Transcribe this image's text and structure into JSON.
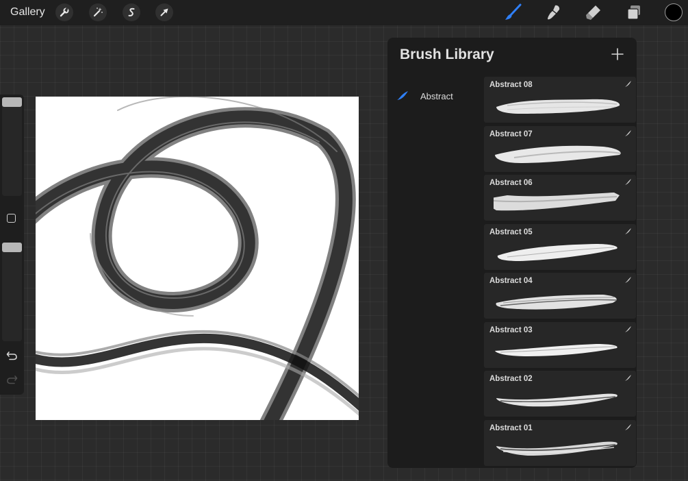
{
  "topbar": {
    "gallery_label": "Gallery",
    "left_tools": [
      "wrench-icon",
      "magic-wand-icon",
      "selection-icon",
      "transform-arrow-icon"
    ],
    "right_tools": [
      "brush-icon",
      "smudge-icon",
      "eraser-icon",
      "layers-icon"
    ],
    "active_tool": "brush-icon",
    "active_tool_color": "#2f7ff6",
    "current_color": "#000000"
  },
  "sidebar": {
    "brush_size_level": 1.0,
    "opacity_level": 1.0,
    "icons": [
      "modify-square-icon",
      "undo-icon",
      "redo-icon"
    ]
  },
  "panel": {
    "title": "Brush Library",
    "add_icon": "plus-icon",
    "brush_sets": [
      {
        "label": "Abstract",
        "icon": "brush-set-stroke-icon",
        "selected": true
      }
    ],
    "brushes": [
      {
        "name": "Abstract 08"
      },
      {
        "name": "Abstract 07"
      },
      {
        "name": "Abstract 06"
      },
      {
        "name": "Abstract 05"
      },
      {
        "name": "Abstract 04"
      },
      {
        "name": "Abstract 03"
      },
      {
        "name": "Abstract 02"
      },
      {
        "name": "Abstract 01"
      }
    ]
  },
  "colors": {
    "background": "#2b2b2b",
    "topbar": "#1f1f1f",
    "panel": "#1c1c1c",
    "card": "#272727",
    "accent": "#2f7ff6"
  }
}
